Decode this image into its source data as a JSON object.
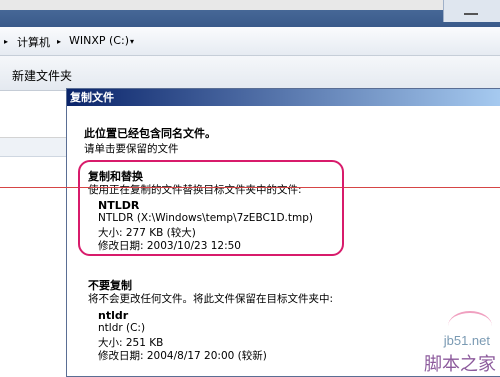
{
  "address_bar": {
    "crumb_computer": "计算机",
    "crumb_drive": "WINXP (C:)"
  },
  "toolbar": {
    "new_folder": "新建文件夹"
  },
  "dialog": {
    "title": "复制文件",
    "main_heading": "此位置已经包含同名文件。",
    "main_sub": "请单击要保留的文件",
    "replace": {
      "heading": "复制和替换",
      "description": "使用正在复制的文件替换目标文件夹中的文件:",
      "file_name": "NTLDR",
      "file_path": "NTLDR (X:\\Windows\\temp\\7zEBC1D.tmp)",
      "size": "大小: 277 KB (较大)",
      "modified": "修改日期: 2003/10/23 12:50"
    },
    "skip": {
      "heading": "不要复制",
      "description": "将不会更改任何文件。将此文件保留在目标文件夹中:",
      "file_name": "ntldr",
      "file_path": "ntldr (C:)",
      "size": "大小: 251 KB",
      "modified": "修改日期: 2004/8/17 20:00 (较新)"
    }
  },
  "watermark": {
    "url": "jb51.net",
    "name": "脚本之家"
  }
}
